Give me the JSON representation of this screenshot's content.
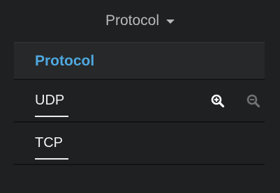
{
  "header": {
    "title": "Protocol"
  },
  "table": {
    "column_header": "Protocol",
    "rows": [
      {
        "label": "UDP",
        "has_zoom_icons": true
      },
      {
        "label": "TCP",
        "has_zoom_icons": false
      }
    ]
  },
  "icons": {
    "zoom_in": "zoom-in-icon",
    "zoom_out": "zoom-out-icon",
    "dropdown": "caret-down-icon"
  },
  "colors": {
    "background": "#1f2021",
    "header_text": "#b9b9b9",
    "accent": "#4ea8e0",
    "row_text": "#f2f2f2",
    "icon_active": "#ffffff",
    "icon_inactive": "#6f7173"
  }
}
